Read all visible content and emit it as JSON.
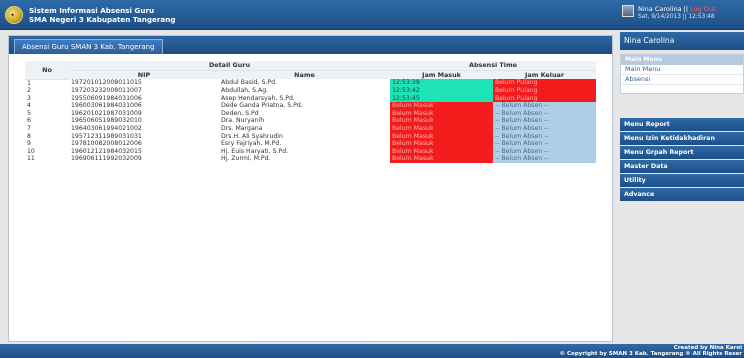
{
  "header": {
    "title_line1": "Sistem Informasi Absensi Guru",
    "title_line2": "SMA Negeri 3 Kabupaten Tangerang",
    "user_name": "Nina Carolina ||",
    "logout_label": "Log Out",
    "datetime": "Sat, 9/14/2013 || 12:53:48"
  },
  "panel": {
    "tab_label": "Absensi Guru SMAN 3 Kab. Tangerang"
  },
  "table": {
    "col_no": "No",
    "group_detail": "Detail Guru",
    "group_absensi": "Absensi Time",
    "col_nip": "NIP",
    "col_nama": "Name",
    "col_masuk": "Jam Masuk",
    "col_keluar": "Jam Keluar",
    "rows": [
      {
        "no": "1",
        "nip": "197201012008011015",
        "nama": "Abdul Basid, S.Pd.",
        "masuk": "12:53:39",
        "masuk_status": "ok",
        "keluar": "Belum Pulang",
        "keluar_status": "red"
      },
      {
        "no": "2",
        "nip": "197203232008011007",
        "nama": "Abdullah, S.Ag.",
        "masuk": "12:53:42",
        "masuk_status": "ok",
        "keluar": "Belum Pulang",
        "keluar_status": "red"
      },
      {
        "no": "3",
        "nip": "195506091984031006",
        "nama": "Asep Hendarsyah, S.Pd.",
        "masuk": "12:53:45",
        "masuk_status": "ok",
        "keluar": "Belum Pulang",
        "keluar_status": "red"
      },
      {
        "no": "4",
        "nip": "196003061984031006",
        "nama": "Dede Ganda Priatna, S.Pd.",
        "masuk": "Belum Masuk",
        "masuk_status": "red",
        "keluar": "-- Belum Absen --",
        "keluar_status": "blue"
      },
      {
        "no": "5",
        "nip": "196201021987031009",
        "nama": "Deden, S.Pd",
        "masuk": "Belum Masuk",
        "masuk_status": "red",
        "keluar": "-- Belum Absen --",
        "keluar_status": "blue"
      },
      {
        "no": "6",
        "nip": "196506051989032010",
        "nama": "Dra. Nuryanih",
        "masuk": "Belum Masuk",
        "masuk_status": "red",
        "keluar": "-- Belum Absen --",
        "keluar_status": "blue"
      },
      {
        "no": "7",
        "nip": "196403061994021002",
        "nama": "Drs. Margana",
        "masuk": "Belum Masuk",
        "masuk_status": "red",
        "keluar": "-- Belum Absen --",
        "keluar_status": "blue"
      },
      {
        "no": "8",
        "nip": "195712311989031031",
        "nama": "Drs.H. Ali Syahrudin",
        "masuk": "Belum Masuk",
        "masuk_status": "red",
        "keluar": "-- Belum Absen --",
        "keluar_status": "blue"
      },
      {
        "no": "9",
        "nip": "197810082008012006",
        "nama": "Esry Fajriyah, M.Pd.",
        "masuk": "Belum Masuk",
        "masuk_status": "red",
        "keluar": "-- Belum Absen --",
        "keluar_status": "blue"
      },
      {
        "no": "10",
        "nip": "196012121984032015",
        "nama": "Hj. Euis Haryati, S.Pd.",
        "masuk": "Belum Masuk",
        "masuk_status": "red",
        "keluar": "-- Belum Absen --",
        "keluar_status": "blue"
      },
      {
        "no": "11",
        "nip": "196906111992032009",
        "nama": "Hj. Zurmi, M.Pd.",
        "masuk": "Belum Masuk",
        "masuk_status": "red",
        "keluar": "-- Belum Absen --",
        "keluar_status": "blue"
      }
    ]
  },
  "sidebar": {
    "user_heading": "Nina Carolina",
    "main_menu_title": "Main Menu",
    "main_menu_links": [
      "Main Menu",
      "Absensi"
    ],
    "buttons": [
      "Menu Report",
      "Menu Izin Ketidakhadiran",
      "Menu Grpah Report",
      "Master Data",
      "Utility",
      "Advance"
    ]
  },
  "footer": {
    "created": "Created by Nina Karol",
    "copyright": "© Copyright by SMAN 3 Kab. Tangerang ® All Rights Reser"
  },
  "colors": {
    "ok": "#1ee3b6",
    "belum": "#f21c1c",
    "pending": "#aecde9",
    "brand": "#1d4f86"
  }
}
